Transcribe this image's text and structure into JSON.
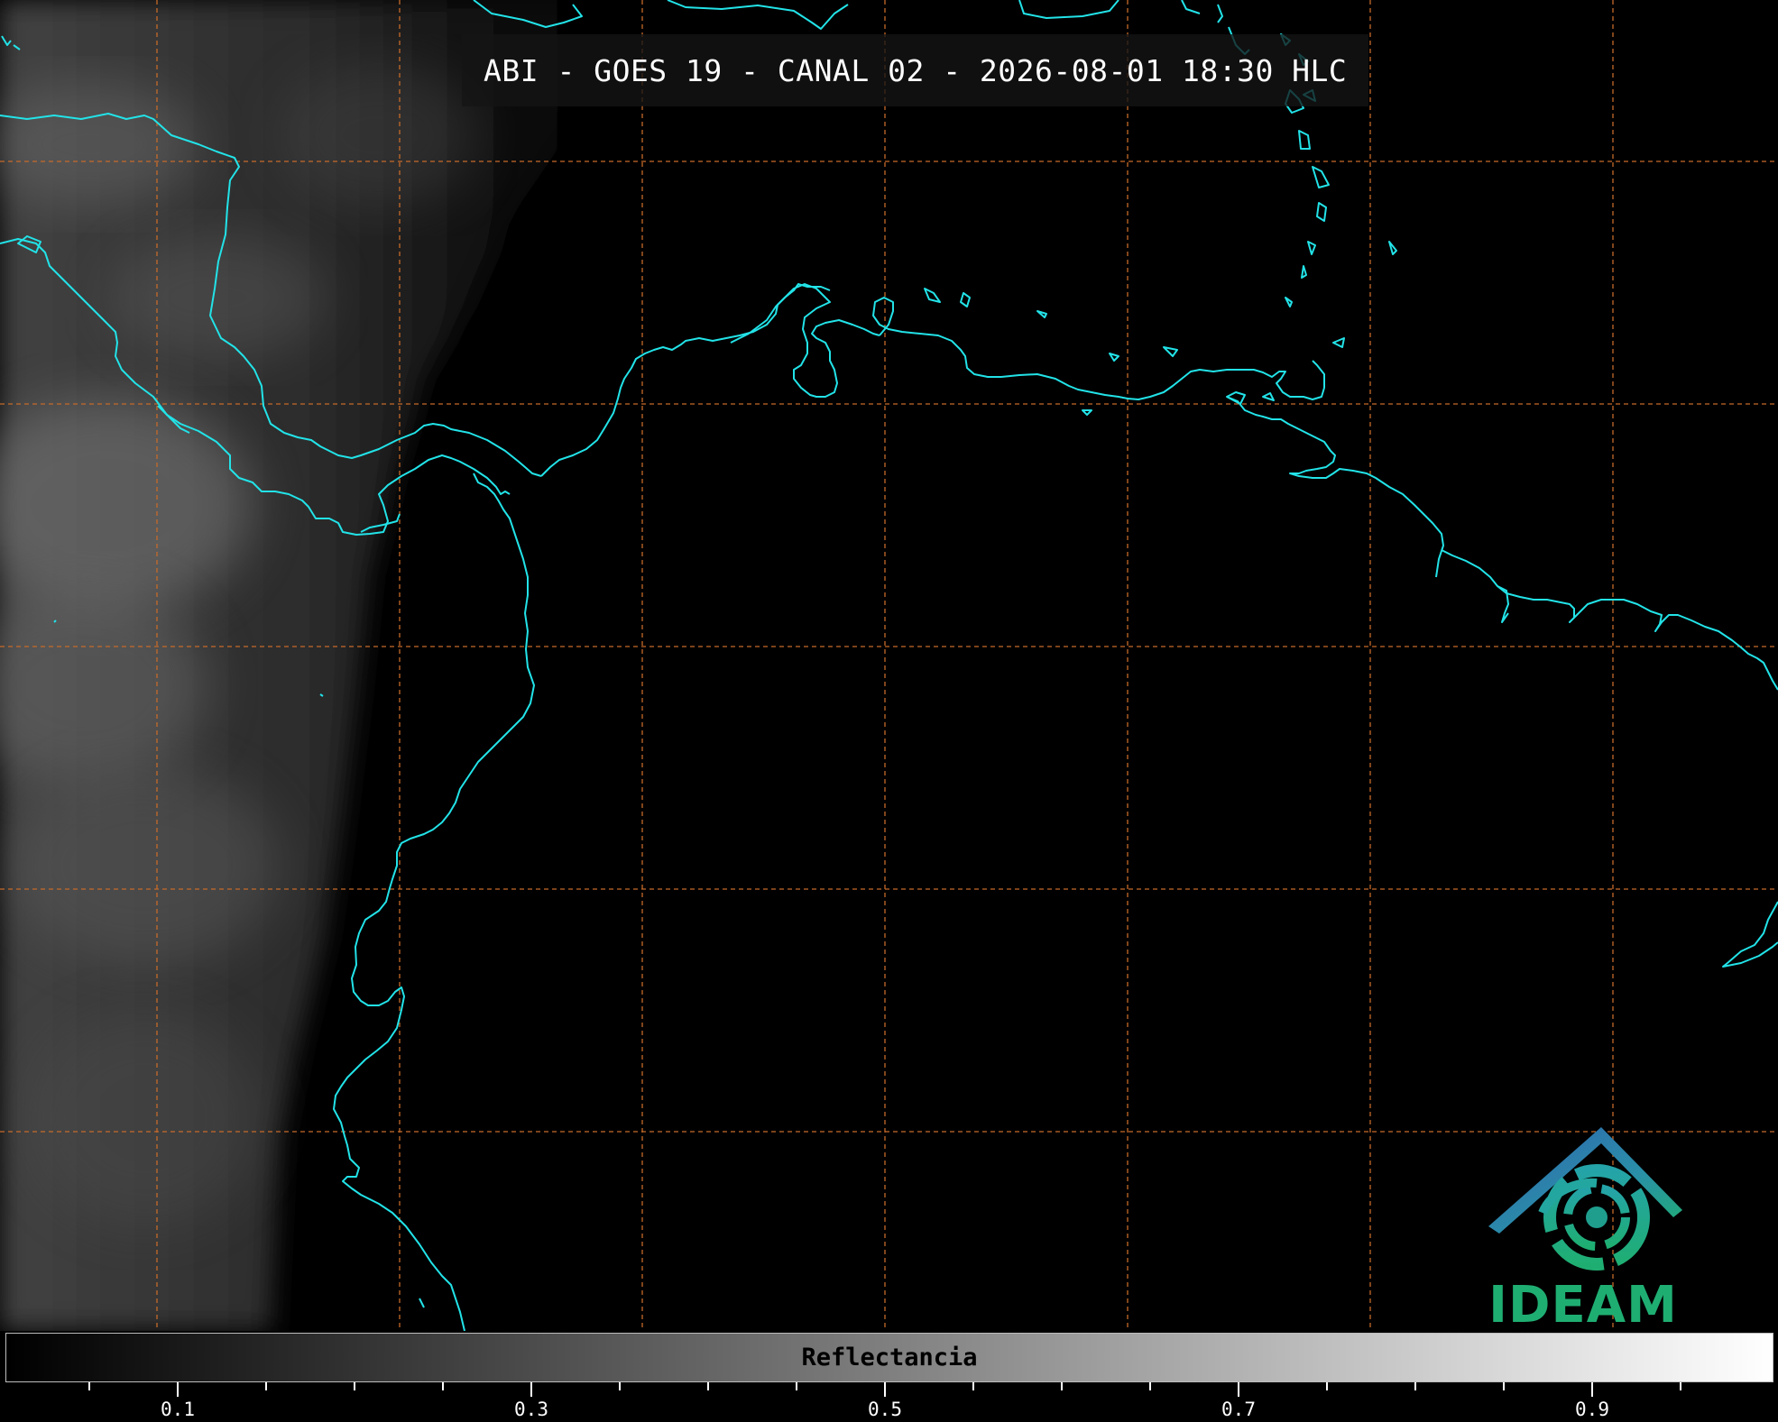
{
  "title": "ABI - GOES 19 - CANAL 02 - 2026-08-01 18:30 HLC",
  "colorbar": {
    "label": "Reflectancia",
    "range": [
      0.0,
      1.0
    ],
    "colors": [
      "#000000",
      "#ffffff"
    ],
    "major_ticks": [
      "0.1",
      "0.3",
      "0.5",
      "0.7",
      "0.9"
    ]
  },
  "logo": {
    "text": "IDEAM",
    "colors": [
      "#2a5fa6",
      "#1fae72",
      "#1f8e9e"
    ]
  },
  "map": {
    "coastline_color": "#22e3e8",
    "graticule_color": "#c56a2a",
    "graticule_style": "dashed",
    "cloud_color": "#8a8a8a"
  }
}
